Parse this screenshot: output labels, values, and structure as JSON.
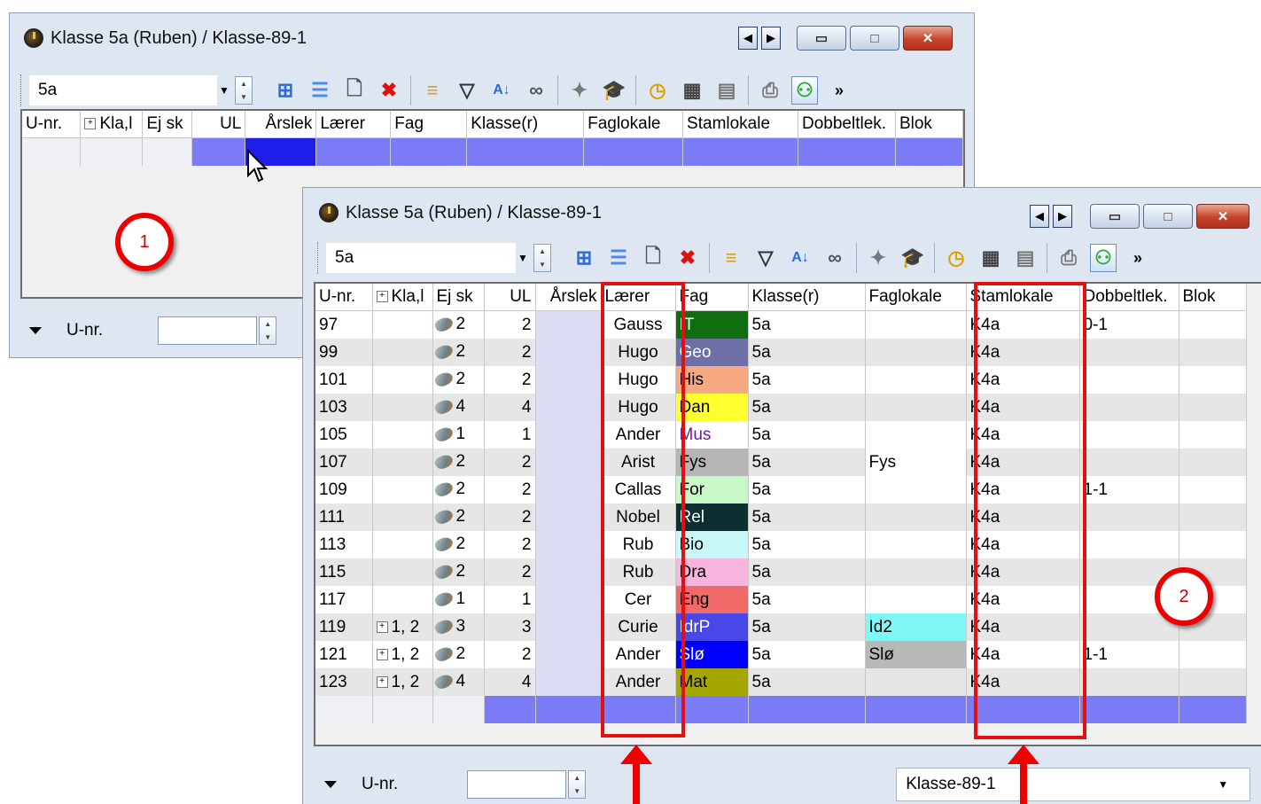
{
  "back_window": {
    "title": "Klasse 5a (Ruben) / Klasse-89-1",
    "class_value": "5a",
    "columns": [
      "U-nr.",
      "Kla,l",
      "Ej sk",
      "UL",
      "Årslek",
      "Lærer",
      "Fag",
      "Klasse(r)",
      "Faglokale",
      "Stamlokale",
      "Dobbeltlek.",
      "Blok"
    ],
    "footer_label": "U-nr.",
    "marker": "1"
  },
  "front_window": {
    "title": "Klasse 5a (Ruben) / Klasse-89-1",
    "class_value": "5a",
    "columns": [
      "U-nr.",
      "Kla,l",
      "Ej sk",
      "UL",
      "Årslek",
      "Lærer",
      "Fag",
      "Klasse(r)",
      "Faglokale",
      "Stamlokale",
      "Dobbeltlek.",
      "Blok"
    ],
    "rows": [
      {
        "unr": "97",
        "kla": "",
        "ejsk": "2",
        "ul": "2",
        "laerer": "Gauss",
        "fag": "IT",
        "klasse": "5a",
        "faglokale": "",
        "stamlokale": "K4a",
        "dobbelt": "0-1"
      },
      {
        "unr": "99",
        "kla": "",
        "ejsk": "2",
        "ul": "2",
        "laerer": "Hugo",
        "fag": "Geo",
        "klasse": "5a",
        "faglokale": "",
        "stamlokale": "K4a",
        "dobbelt": ""
      },
      {
        "unr": "101",
        "kla": "",
        "ejsk": "2",
        "ul": "2",
        "laerer": "Hugo",
        "fag": "His",
        "klasse": "5a",
        "faglokale": "",
        "stamlokale": "K4a",
        "dobbelt": ""
      },
      {
        "unr": "103",
        "kla": "",
        "ejsk": "4",
        "ul": "4",
        "laerer": "Hugo",
        "fag": "Dan",
        "klasse": "5a",
        "faglokale": "",
        "stamlokale": "K4a",
        "dobbelt": ""
      },
      {
        "unr": "105",
        "kla": "",
        "ejsk": "1",
        "ul": "1",
        "laerer": "Ander",
        "fag": "Mus",
        "klasse": "5a",
        "faglokale": "",
        "stamlokale": "K4a",
        "dobbelt": ""
      },
      {
        "unr": "107",
        "kla": "",
        "ejsk": "2",
        "ul": "2",
        "laerer": "Arist",
        "fag": "Fys",
        "klasse": "5a",
        "faglokale": "Fys",
        "stamlokale": "K4a",
        "dobbelt": ""
      },
      {
        "unr": "109",
        "kla": "",
        "ejsk": "2",
        "ul": "2",
        "laerer": "Callas",
        "fag": "For",
        "klasse": "5a",
        "faglokale": "",
        "stamlokale": "K4a",
        "dobbelt": "1-1"
      },
      {
        "unr": "111",
        "kla": "",
        "ejsk": "2",
        "ul": "2",
        "laerer": "Nobel",
        "fag": "Rel",
        "klasse": "5a",
        "faglokale": "",
        "stamlokale": "K4a",
        "dobbelt": ""
      },
      {
        "unr": "113",
        "kla": "",
        "ejsk": "2",
        "ul": "2",
        "laerer": "Rub",
        "fag": "Bio",
        "klasse": "5a",
        "faglokale": "",
        "stamlokale": "K4a",
        "dobbelt": ""
      },
      {
        "unr": "115",
        "kla": "",
        "ejsk": "2",
        "ul": "2",
        "laerer": "Rub",
        "fag": "Dra",
        "klasse": "5a",
        "faglokale": "",
        "stamlokale": "K4a",
        "dobbelt": ""
      },
      {
        "unr": "117",
        "kla": "",
        "ejsk": "1",
        "ul": "1",
        "laerer": "Cer",
        "fag": "Eng",
        "klasse": "5a",
        "faglokale": "",
        "stamlokale": "K4a",
        "dobbelt": ""
      },
      {
        "unr": "119",
        "kla": "1, 2",
        "ejsk": "3",
        "ul": "3",
        "laerer": "Curie",
        "fag": "IdrP",
        "klasse": "5a",
        "faglokale": "Id2",
        "stamlokale": "K4a",
        "dobbelt": ""
      },
      {
        "unr": "121",
        "kla": "1, 2",
        "ejsk": "2",
        "ul": "2",
        "laerer": "Ander",
        "fag": "Slø",
        "klasse": "5a",
        "faglokale": "Slø",
        "stamlokale": "K4a",
        "dobbelt": "1-1"
      },
      {
        "unr": "123",
        "kla": "1, 2",
        "ejsk": "4",
        "ul": "4",
        "laerer": "Ander",
        "fag": "Mat",
        "klasse": "5a",
        "faglokale": "",
        "stamlokale": "K4a",
        "dobbelt": ""
      }
    ],
    "fag_colors": {
      "IT": {
        "bg": "#0f6e0f",
        "fg": "#ffffff"
      },
      "Geo": {
        "bg": "#6f6fa8",
        "fg": "#ffffff"
      },
      "His": {
        "bg": "#f5a882",
        "fg": "#000000"
      },
      "Dan": {
        "bg": "#ffff30",
        "fg": "#000000"
      },
      "Mus": {
        "bg": "#ffffff",
        "fg": "#6a1b9a"
      },
      "Fys": {
        "bg": "#b5b5b5",
        "fg": "#000000"
      },
      "For": {
        "bg": "#c8f7c8",
        "fg": "#000000"
      },
      "Rel": {
        "bg": "#0d2f2f",
        "fg": "#ffffff"
      },
      "Bio": {
        "bg": "#c8f7f7",
        "fg": "#000000"
      },
      "Dra": {
        "bg": "#f7b5dd",
        "fg": "#000000"
      },
      "Eng": {
        "bg": "#f06a6a",
        "fg": "#000000"
      },
      "IdrP": {
        "bg": "#4848e8",
        "fg": "#ffffff"
      },
      "Slø": {
        "bg": "#0000ff",
        "fg": "#ffffff"
      },
      "Mat": {
        "bg": "#a6a600",
        "fg": "#000000"
      }
    },
    "faglokale_colors": {
      "Fys": "#ffffff",
      "Id2": "#7ff7f7",
      "Slø": "#b8b8b8"
    },
    "footer_label": "U-nr.",
    "footer_select": "Klasse-89-1",
    "marker": "2"
  }
}
